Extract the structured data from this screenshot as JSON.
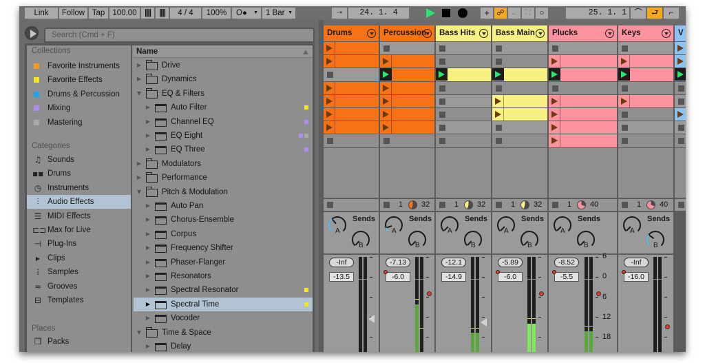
{
  "transport": {
    "link": "Link",
    "follow": "Follow",
    "tap": "Tap",
    "tempo": "100.00",
    "nudge_down": "||||",
    "nudge_up": "||||",
    "time_signature": "4 / 4",
    "zoom": "100%",
    "metronome": "O●",
    "quantize": "1 Bar",
    "arrangement_position": "24.  1.  4",
    "loop_length": "25.  1.  1"
  },
  "browser": {
    "search_placeholder": "Search (Cmd + F)",
    "collections_header": "Collections",
    "collections": [
      {
        "label": "Favorite Instruments",
        "color": "#f39a1e"
      },
      {
        "label": "Favorite Effects",
        "color": "#f4e524"
      },
      {
        "label": "Drums & Percussion",
        "color": "#1fa4ef"
      },
      {
        "label": "Mixing",
        "color": "#b08cf2"
      },
      {
        "label": "Mastering",
        "color": "#a9a9a9"
      }
    ],
    "categories_header": "Categories",
    "categories": [
      {
        "label": "Sounds",
        "icon": "music-note-icon",
        "glyph": "♫"
      },
      {
        "label": "Drums",
        "icon": "drum-grid-icon",
        "glyph": "▪▪"
      },
      {
        "label": "Instruments",
        "icon": "clock-icon",
        "glyph": "◷"
      },
      {
        "label": "Audio Effects",
        "icon": "waveform-icon",
        "glyph": "⫶",
        "selected": true
      },
      {
        "label": "MIDI Effects",
        "icon": "midi-effects-icon",
        "glyph": "☰"
      },
      {
        "label": "Max for Live",
        "icon": "max-for-live-icon",
        "glyph": "⊏⊐"
      },
      {
        "label": "Plug-Ins",
        "icon": "plug-icon",
        "glyph": "⊣"
      },
      {
        "label": "Clips",
        "icon": "clip-icon",
        "glyph": "▸"
      },
      {
        "label": "Samples",
        "icon": "sample-icon",
        "glyph": "⁞"
      },
      {
        "label": "Grooves",
        "icon": "groove-icon",
        "glyph": "≈"
      },
      {
        "label": "Templates",
        "icon": "template-icon",
        "glyph": "⊟"
      }
    ],
    "places_header": "Places",
    "places": [
      {
        "label": "Packs",
        "icon": "packs-icon",
        "glyph": "❐"
      }
    ],
    "list_header": "Name",
    "items": [
      {
        "label": "Drive",
        "type": "folder",
        "depth": 0,
        "expanded": false,
        "tags": []
      },
      {
        "label": "Dynamics",
        "type": "folder",
        "depth": 0,
        "expanded": false,
        "tags": []
      },
      {
        "label": "EQ & Filters",
        "type": "folder",
        "depth": 0,
        "expanded": true,
        "tags": []
      },
      {
        "label": "Auto Filter",
        "type": "device",
        "depth": 1,
        "tags": [
          "#f4e524"
        ]
      },
      {
        "label": "Channel EQ",
        "type": "device",
        "depth": 1,
        "tags": [
          "#b08cf2"
        ]
      },
      {
        "label": "EQ Eight",
        "type": "device",
        "depth": 1,
        "tags": [
          "#b08cf2",
          "#a9a9a9"
        ]
      },
      {
        "label": "EQ Three",
        "type": "device",
        "depth": 1,
        "tags": [
          "#b08cf2"
        ]
      },
      {
        "label": "Modulators",
        "type": "folder",
        "depth": 0,
        "expanded": false,
        "tags": []
      },
      {
        "label": "Performance",
        "type": "folder",
        "depth": 0,
        "expanded": false,
        "tags": []
      },
      {
        "label": "Pitch & Modulation",
        "type": "folder",
        "depth": 0,
        "expanded": true,
        "tags": []
      },
      {
        "label": "Auto Pan",
        "type": "device",
        "depth": 1,
        "tags": []
      },
      {
        "label": "Chorus-Ensemble",
        "type": "device",
        "depth": 1,
        "tags": []
      },
      {
        "label": "Corpus",
        "type": "device",
        "depth": 1,
        "tags": []
      },
      {
        "label": "Frequency Shifter",
        "type": "device",
        "depth": 1,
        "tags": []
      },
      {
        "label": "Phaser-Flanger",
        "type": "device",
        "depth": 1,
        "tags": []
      },
      {
        "label": "Resonators",
        "type": "device",
        "depth": 1,
        "tags": []
      },
      {
        "label": "Spectral Resonator",
        "type": "device",
        "depth": 1,
        "tags": [
          "#f4e524"
        ]
      },
      {
        "label": "Spectral Time",
        "type": "device",
        "depth": 1,
        "tags": [
          "#f4e524"
        ],
        "selected": true
      },
      {
        "label": "Vocoder",
        "type": "device",
        "depth": 1,
        "tags": []
      },
      {
        "label": "Time & Space",
        "type": "folder",
        "depth": 0,
        "expanded": true,
        "tags": []
      },
      {
        "label": "Delay",
        "type": "device",
        "depth": 1,
        "tags": []
      }
    ]
  },
  "tracks": [
    {
      "name": "Drums",
      "color": "#f77214",
      "slots": [
        "clip",
        "clip",
        "stop",
        "clip",
        "clip",
        "clip",
        "clip",
        "stop"
      ],
      "status": {
        "show": false
      },
      "send_a": 0.35,
      "send_b": 0.0,
      "volume": "-Inf",
      "volume_box": "-13.5",
      "volume_box_dot": false,
      "meter_level": 0.0,
      "fader": 0.3,
      "fader_style": "triangle"
    },
    {
      "name": "Percussion",
      "color": "#f77214",
      "slots": [
        "stop",
        "clip",
        "playing",
        "clip",
        "clip",
        "clip",
        "clip",
        "stop"
      ],
      "status": {
        "show": true,
        "left": "1",
        "right": "32",
        "progress": 0.55
      },
      "send_a": 0.1,
      "send_b": 0.0,
      "volume": "-7.13",
      "volume_box": "-6.0",
      "volume_box_dot": true,
      "meter_level": 0.5,
      "fader": 0.58,
      "fader_style": "dot"
    },
    {
      "name": "Bass Hits",
      "color": "#f6f181",
      "slots": [
        "stop",
        "stop",
        "playing",
        "stop",
        "stop",
        "stop",
        "stop",
        "stop"
      ],
      "status": {
        "show": true,
        "left": "1",
        "right": "32",
        "progress": 0.55
      },
      "send_a": 0.0,
      "send_b": 0.0,
      "volume": "-12.1",
      "volume_box": "-14.9",
      "volume_box_dot": false,
      "meter_level": 0.2,
      "fader": 0.26,
      "fader_style": "triangle"
    },
    {
      "name": "Bass Main",
      "color": "#f6f181",
      "slots": [
        "stop",
        "stop",
        "playing",
        "stop",
        "clip",
        "clip",
        "stop",
        "stop"
      ],
      "status": {
        "show": true,
        "left": "1",
        "right": "32",
        "progress": 0.55
      },
      "send_a": 0.0,
      "send_b": 0.0,
      "volume": "-5.89",
      "volume_box": "-6.0",
      "volume_box_dot": true,
      "meter_level": 0.3,
      "fader": 0.58,
      "fader_style": "dot",
      "bright_meter": true
    },
    {
      "name": "Plucks",
      "color": "#fb929e",
      "slots": [
        "stop",
        "clip",
        "playing",
        "stop",
        "clip",
        "clip",
        "clip",
        "clip"
      ],
      "status": {
        "show": true,
        "left": "1",
        "right": "40",
        "progress": 0.3
      },
      "send_a": 0.0,
      "send_b": 0.0,
      "volume": "-8.52",
      "volume_box": "-5.5",
      "volume_box_dot": true,
      "meter_level": 0.22,
      "fader": 0.58,
      "fader_style": "dot",
      "db_scale": [
        "6",
        "0",
        "6",
        "12",
        "18"
      ]
    },
    {
      "name": "Keys",
      "color": "#fb929e",
      "slots": [
        "stop",
        "clip",
        "playing",
        "stop",
        "clip",
        "stop",
        "stop",
        "stop"
      ],
      "status": {
        "show": true,
        "left": "1",
        "right": "40",
        "progress": 0.3
      },
      "send_a": 0.0,
      "send_b": 0.3,
      "volume": "-Inf",
      "volume_box": "-16.0",
      "volume_box_dot": true,
      "meter_level": 0.0,
      "fader": 0.2,
      "fader_style": "dot"
    },
    {
      "name": "V",
      "color": "#8cc3f0",
      "slots": [
        "clip",
        "clip",
        "playing",
        "stop",
        "stop",
        "clip",
        "stop",
        "stop"
      ],
      "status": {
        "show": true,
        "left": "",
        "right": "",
        "progress": 0
      },
      "partial": true
    }
  ],
  "labels": {
    "sends": "Sends",
    "knob_a": "A",
    "knob_b": "B"
  },
  "colors": {
    "play_green": "#2ee36e",
    "accent_orange": "#f4aa1c",
    "selection_blue": "#b2c4d3",
    "send_cyan": "#54c8f0"
  }
}
